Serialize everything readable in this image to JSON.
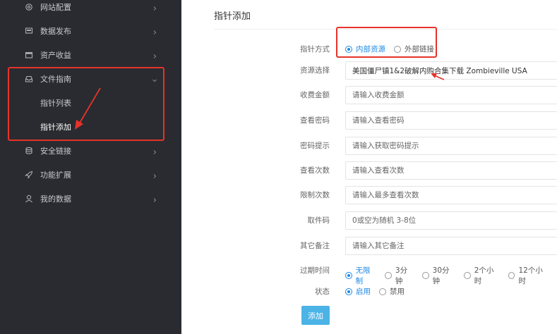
{
  "sidebar": {
    "items": [
      {
        "label": "网站配置",
        "icon": "gear-icon"
      },
      {
        "label": "数据发布",
        "icon": "monitor-icon"
      },
      {
        "label": "资产收益",
        "icon": "wallet-icon"
      },
      {
        "label": "文件指南",
        "icon": "inbox-icon",
        "expanded": true,
        "children": [
          {
            "label": "指针列表"
          },
          {
            "label": "指针添加",
            "active": true
          }
        ]
      },
      {
        "label": "安全链接",
        "icon": "database-icon"
      },
      {
        "label": "功能扩展",
        "icon": "rocket-icon"
      },
      {
        "label": "我的数据",
        "icon": "user-icon"
      }
    ]
  },
  "main": {
    "title": "指针添加",
    "form": {
      "pointer_mode": {
        "label": "指针方式",
        "options": [
          "内部资源",
          "外部链接"
        ],
        "selected": "内部资源"
      },
      "resource": {
        "label": "资源选择",
        "value": "美国僵尸镇1&2破解内购合集下载 Zombieville USA"
      },
      "fee": {
        "label": "收费金额",
        "placeholder": "请输入收费金额"
      },
      "view_password": {
        "label": "查看密码",
        "placeholder": "请输入查看密码"
      },
      "password_hint": {
        "label": "密码提示",
        "placeholder": "请输入获取密码提示"
      },
      "view_count": {
        "label": "查看次数",
        "placeholder": "请输入查看次数"
      },
      "limit_count": {
        "label": "限制次数",
        "placeholder": "请输入最多查看次数"
      },
      "pickup_code": {
        "label": "取件码",
        "placeholder": "0或空为随机 3-8位"
      },
      "remark": {
        "label": "其它备注",
        "placeholder": "请输入其它备注"
      },
      "expire": {
        "label": "过期时间",
        "options": [
          "无限制",
          "3分钟",
          "30分钟",
          "2个小时",
          "12个小时"
        ],
        "selected": "无限制"
      },
      "status": {
        "label": "状态",
        "options": [
          "启用",
          "禁用"
        ],
        "selected": "启用"
      },
      "submit_label": "添加"
    }
  },
  "colors": {
    "sidebar_bg": "#2a2b30",
    "accent": "#1e88e5",
    "button": "#4bb3e6",
    "highlight": "#e6332a"
  }
}
